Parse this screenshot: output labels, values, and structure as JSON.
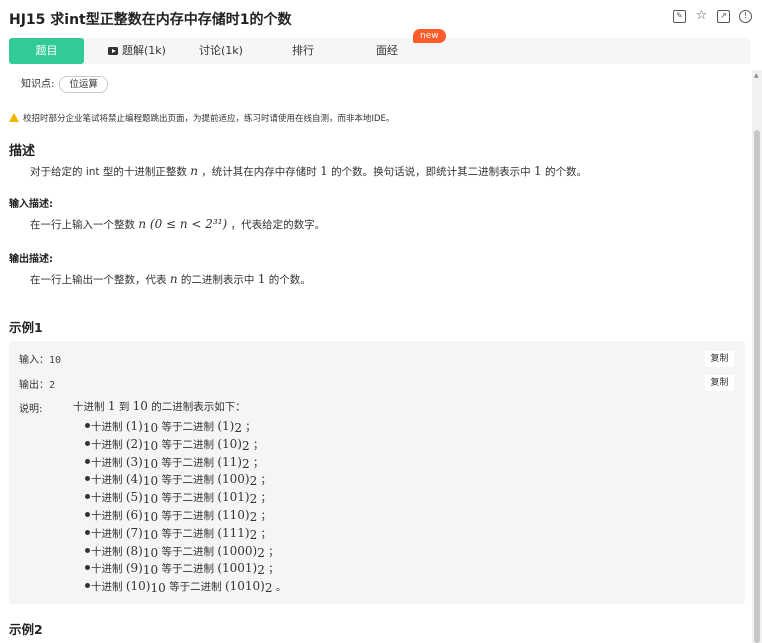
{
  "problem": {
    "title": "HJ15  求int型正整数在内存中存储时1的个数"
  },
  "header_icons": [
    "edit-icon",
    "star-icon",
    "share-icon",
    "info-icon"
  ],
  "tabs": [
    {
      "label": "题目",
      "active": true
    },
    {
      "label": "题解(1k)",
      "icon": "video-icon"
    },
    {
      "label": "讨论(1k)"
    },
    {
      "label": "排行"
    },
    {
      "label": "面经",
      "badge": "new"
    }
  ],
  "knowledge": {
    "label": "知识点:",
    "tag": "位运算"
  },
  "warning": "校招时部分企业笔试将禁止编程题跳出页面，为提前适应，练习时请使用在线自测，而非本地IDE。",
  "description": {
    "heading": "描述",
    "text_before": "对于给定的 int 型的十进制正整数",
    "var_n": "n",
    "text_mid": "，统计其在内存中存储时",
    "num_one": "1",
    "text_mid2": "的个数。换句话说，即统计其二进制表示中",
    "num_one_b": "1",
    "text_after": "的个数。"
  },
  "input_desc": {
    "heading": "输入描述:",
    "text_before": "在一行上输入一个整数",
    "math": "n (0 ≤ n < 2³¹)",
    "text_after": "，代表给定的数字。"
  },
  "output_desc": {
    "heading": "输出描述:",
    "text_before": "在一行上输出一个整数，代表",
    "var_n": "n",
    "text_mid": "的二进制表示中",
    "num_one": "1",
    "text_after": "的个数。"
  },
  "example1": {
    "heading": "示例1",
    "input_label": "输入：",
    "input_value": "10",
    "output_label": "输出：",
    "output_value": "2",
    "copy_label": "复制",
    "explain_label": "说明:",
    "explain_intro_a": "十进制",
    "explain_from": "1",
    "explain_to_word": "到",
    "explain_to": "10",
    "explain_intro_b": "的二进制表示如下：",
    "rows": [
      {
        "prefix": "十进制",
        "dec": "(1)",
        "mid": "等于二进制",
        "bin": "(1)",
        "end": "；"
      },
      {
        "prefix": "十进制",
        "dec": "(2)",
        "mid": "等于二进制",
        "bin": "(10)",
        "end": "；"
      },
      {
        "prefix": "十进制",
        "dec": "(3)",
        "mid": "等于二进制",
        "bin": "(11)",
        "end": "；"
      },
      {
        "prefix": "十进制",
        "dec": "(4)",
        "mid": "等于二进制",
        "bin": "(100)",
        "end": "；"
      },
      {
        "prefix": "十进制",
        "dec": "(5)",
        "mid": "等于二进制",
        "bin": "(101)",
        "end": "；"
      },
      {
        "prefix": "十进制",
        "dec": "(6)",
        "mid": "等于二进制",
        "bin": "(110)",
        "end": "；"
      },
      {
        "prefix": "十进制",
        "dec": "(7)",
        "mid": "等于二进制",
        "bin": "(111)",
        "end": "；"
      },
      {
        "prefix": "十进制",
        "dec": "(8)",
        "mid": "等于二进制",
        "bin": "(1000)",
        "end": "；"
      },
      {
        "prefix": "十进制",
        "dec": "(9)",
        "mid": "等于二进制",
        "bin": "(1001)",
        "end": "；"
      },
      {
        "prefix": "十进制",
        "dec": "(10)",
        "mid": "等于二进制",
        "bin": "(1010)",
        "end": "。"
      }
    ],
    "dec_sub": "10",
    "bin_sub": "2"
  },
  "example2": {
    "heading": "示例2"
  },
  "colors": {
    "accent": "#32ca99",
    "badge": "#ff5a2a",
    "warning": "#f3b400"
  }
}
